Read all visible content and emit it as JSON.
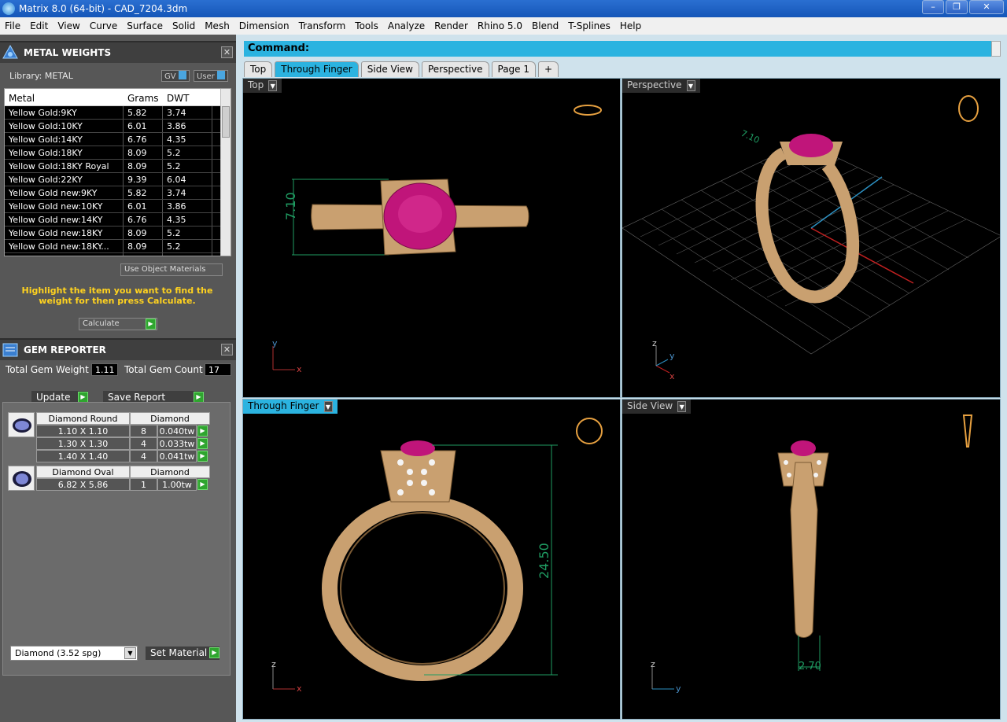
{
  "window": {
    "title": "Matrix 8.0 (64-bit) - CAD_7204.3dm",
    "minimize": "–",
    "maximize": "❐",
    "close": "✕"
  },
  "menu": [
    "File",
    "Edit",
    "View",
    "Curve",
    "Surface",
    "Solid",
    "Mesh",
    "Dimension",
    "Transform",
    "Tools",
    "Analyze",
    "Render",
    "Rhino 5.0",
    "Blend",
    "T-Splines",
    "Help"
  ],
  "metal_weights": {
    "title": "METAL WEIGHTS",
    "library_label": "Library: METAL",
    "gv_toggle": "GV",
    "user_toggle": "User",
    "columns": [
      "Metal",
      "Grams",
      "DWT"
    ],
    "rows": [
      [
        "Yellow Gold:9KY",
        "5.82",
        "3.74"
      ],
      [
        "Yellow Gold:10KY",
        "6.01",
        "3.86"
      ],
      [
        "Yellow Gold:14KY",
        "6.76",
        "4.35"
      ],
      [
        "Yellow Gold:18KY",
        "8.09",
        "5.2"
      ],
      [
        "Yellow Gold:18KY Royal",
        "8.09",
        "5.2"
      ],
      [
        "Yellow Gold:22KY",
        "9.39",
        "6.04"
      ],
      [
        "Yellow Gold new:9KY",
        "5.82",
        "3.74"
      ],
      [
        "Yellow Gold new:10KY",
        "6.01",
        "3.86"
      ],
      [
        "Yellow Gold new:14KY",
        "6.76",
        "4.35"
      ],
      [
        "Yellow Gold new:18KY",
        "8.09",
        "5.2"
      ],
      [
        "Yellow Gold new:18KY...",
        "8.09",
        "5.2"
      ],
      [
        "Yellow Gold new:22KY",
        "9.39",
        "6.04"
      ]
    ],
    "use_object_materials": "Use Object Materials",
    "hint": "Highlight the item you want to find the weight for then press Calculate.",
    "calculate": "Calculate"
  },
  "gem_reporter": {
    "title": "GEM REPORTER",
    "total_weight_label": "Total Gem Weight",
    "total_weight_value": "1.11",
    "total_count_label": "Total Gem Count",
    "total_count_value": "17",
    "update": "Update",
    "save_report": "Save Report",
    "groups": [
      {
        "shape": "Diamond Round",
        "material": "Diamond",
        "rows": [
          [
            "1.10 X 1.10",
            "8",
            "0.040tw"
          ],
          [
            "1.30 X 1.30",
            "4",
            "0.033tw"
          ],
          [
            "1.40 X 1.40",
            "4",
            "0.041tw"
          ]
        ]
      },
      {
        "shape": "Diamond Oval",
        "material": "Diamond",
        "rows": [
          [
            "6.82 X 5.86",
            "1",
            "1.00tw"
          ]
        ]
      }
    ],
    "material_select": "Diamond     (3.52 spg)",
    "set_material": "Set Material"
  },
  "command": {
    "label": "Command:"
  },
  "tabs": [
    "Top",
    "Through Finger",
    "Side View",
    "Perspective",
    "Page 1",
    "+"
  ],
  "viewports": {
    "top": {
      "label": "Top",
      "dimension": "7.10",
      "axis_x": "x",
      "axis_y": "y"
    },
    "perspective": {
      "label": "Perspective",
      "dimension": "7.10",
      "axis_x": "x",
      "axis_y": "y",
      "axis_z": "z"
    },
    "through_finger": {
      "label": "Through Finger",
      "dimension": "24.50",
      "axis_x": "x",
      "axis_z": "z"
    },
    "side_view": {
      "label": "Side View",
      "dimension": "2.70",
      "axis_y": "y",
      "axis_z": "z"
    }
  },
  "colors": {
    "accent": "#2bb3e0",
    "gold": "#c9a070",
    "ruby": "#c0157a",
    "dim": "#1f9c62",
    "hint": "#ffd21f"
  }
}
